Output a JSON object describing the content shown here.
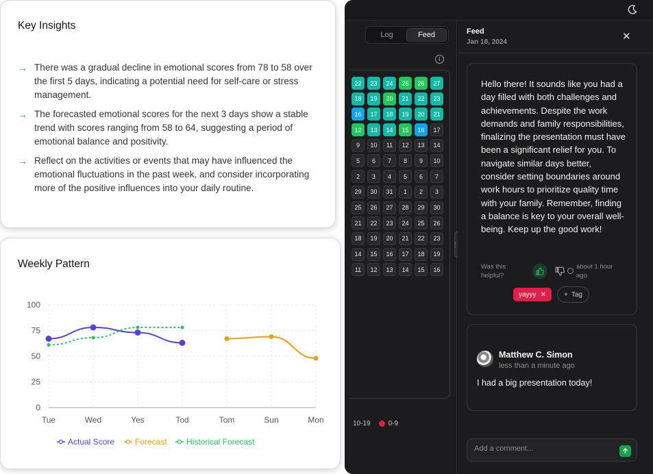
{
  "app": {
    "tabs": [
      "Log",
      "Feed"
    ],
    "active_tab": "Feed",
    "heatmap": {
      "rows": [
        [
          {
            "v": "22",
            "c": "t"
          },
          {
            "v": "23",
            "c": "t"
          },
          {
            "v": "24",
            "c": "t"
          },
          {
            "v": "25",
            "c": "g"
          },
          {
            "v": "26",
            "c": "g"
          },
          {
            "v": "27",
            "c": "t"
          }
        ],
        [
          {
            "v": "18",
            "c": "t"
          },
          {
            "v": "19",
            "c": "t"
          },
          {
            "v": "20",
            "c": "g"
          },
          {
            "v": "21",
            "c": "t"
          },
          {
            "v": "22",
            "c": "t"
          },
          {
            "v": "23",
            "c": "t"
          }
        ],
        [
          {
            "v": "16",
            "c": "b"
          },
          {
            "v": "17",
            "c": "t"
          },
          {
            "v": "18",
            "c": "t"
          },
          {
            "v": "19",
            "c": "t"
          },
          {
            "v": "20",
            "c": "t"
          },
          {
            "v": "21",
            "c": "t"
          }
        ],
        [
          {
            "v": "12",
            "c": "g"
          },
          {
            "v": "13",
            "c": "t"
          },
          {
            "v": "14",
            "c": "t"
          },
          {
            "v": "15",
            "c": "g"
          },
          {
            "v": "16",
            "c": "b"
          },
          {
            "v": "17",
            "c": ""
          }
        ],
        [
          {
            "v": "9"
          },
          {
            "v": "10"
          },
          {
            "v": "11"
          },
          {
            "v": "12"
          },
          {
            "v": "13"
          },
          {
            "v": "14"
          }
        ],
        [
          {
            "v": "5"
          },
          {
            "v": "6"
          },
          {
            "v": "7"
          },
          {
            "v": "8"
          },
          {
            "v": "9"
          },
          {
            "v": "10"
          }
        ],
        [
          {
            "v": "2"
          },
          {
            "v": "3"
          },
          {
            "v": "4"
          },
          {
            "v": "5"
          },
          {
            "v": "6"
          },
          {
            "v": "7"
          }
        ],
        [
          {
            "v": "29"
          },
          {
            "v": "30"
          },
          {
            "v": "31"
          },
          {
            "v": "1"
          },
          {
            "v": "2"
          },
          {
            "v": "3"
          }
        ],
        [
          {
            "v": "25"
          },
          {
            "v": "26"
          },
          {
            "v": "27"
          },
          {
            "v": "28"
          },
          {
            "v": "29"
          },
          {
            "v": "30"
          }
        ],
        [
          {
            "v": "21"
          },
          {
            "v": "22"
          },
          {
            "v": "23"
          },
          {
            "v": "24"
          },
          {
            "v": "25"
          },
          {
            "v": "26"
          }
        ],
        [
          {
            "v": "18"
          },
          {
            "v": "19"
          },
          {
            "v": "20"
          },
          {
            "v": "21"
          },
          {
            "v": "22"
          },
          {
            "v": "23"
          }
        ],
        [
          {
            "v": "14"
          },
          {
            "v": "15"
          },
          {
            "v": "16"
          },
          {
            "v": "17"
          },
          {
            "v": "18"
          },
          {
            "v": "19"
          }
        ],
        [
          {
            "v": "11"
          },
          {
            "v": "12"
          },
          {
            "v": "13"
          },
          {
            "v": "14"
          },
          {
            "v": "15"
          },
          {
            "v": "16"
          }
        ]
      ]
    },
    "legend": [
      "10-19",
      "0-9"
    ],
    "feed": {
      "title": "Feed",
      "date": "Jan 18, 2024",
      "close_icon": "close-icon",
      "message": "Hello there! It sounds like you had a day filled with both challenges and achievements. Despite the work demands and family responsibilities, finalizing the presentation must have been a significant relief for you. To navigate similar days better, consider setting boundaries around work hours to prioritize quality time with your family. Remember, finding a balance is key to your overall well-being. Keep up the good work!",
      "helpful_label": "Was this helpful?",
      "time_ago": "about 1 hour ago",
      "tag": "yayyy",
      "add_tag_label": "Tag",
      "comment": {
        "author": "Matthew C. Simon",
        "time": "less than a minute ago",
        "text": "I had a big presentation today!"
      },
      "comment_placeholder": "Add a comment..."
    }
  },
  "insights": {
    "title": "Key Insights",
    "items": [
      "There was a gradual decline in emotional scores from 78 to 58 over the first 5 days, indicating a potential need for self-care or stress management.",
      "The forecasted emotional scores for the next 3 days show a stable trend with scores ranging from 58 to 64, suggesting a period of emotional balance and positivity.",
      "Reflect on the activities or events that may have influenced the emotional fluctuations in the past week, and consider incorporating more of the positive influences into your daily routine."
    ]
  },
  "weekly": {
    "title": "Weekly Pattern"
  },
  "chart_data": {
    "type": "line",
    "title": "Weekly Pattern",
    "categories": [
      "Tue",
      "Wed",
      "Yes",
      "Tod",
      "Tom",
      "Sun",
      "Mon"
    ],
    "ylim": [
      0,
      100
    ],
    "yticks": [
      0,
      25,
      50,
      75,
      100
    ],
    "grid": true,
    "legend_position": "bottom",
    "series": [
      {
        "name": "Actual Score",
        "color": "#5b3fd6",
        "style": "solid",
        "values": [
          67,
          78,
          73,
          63,
          null,
          null,
          null
        ]
      },
      {
        "name": "Forecast",
        "color": "#f59e0b",
        "style": "solid",
        "values": [
          null,
          null,
          null,
          null,
          67,
          69,
          48
        ]
      },
      {
        "name": "Historical Forecast",
        "color": "#22c55e",
        "style": "dashed",
        "values": [
          61,
          68,
          78,
          78,
          null,
          null,
          null
        ]
      }
    ]
  }
}
